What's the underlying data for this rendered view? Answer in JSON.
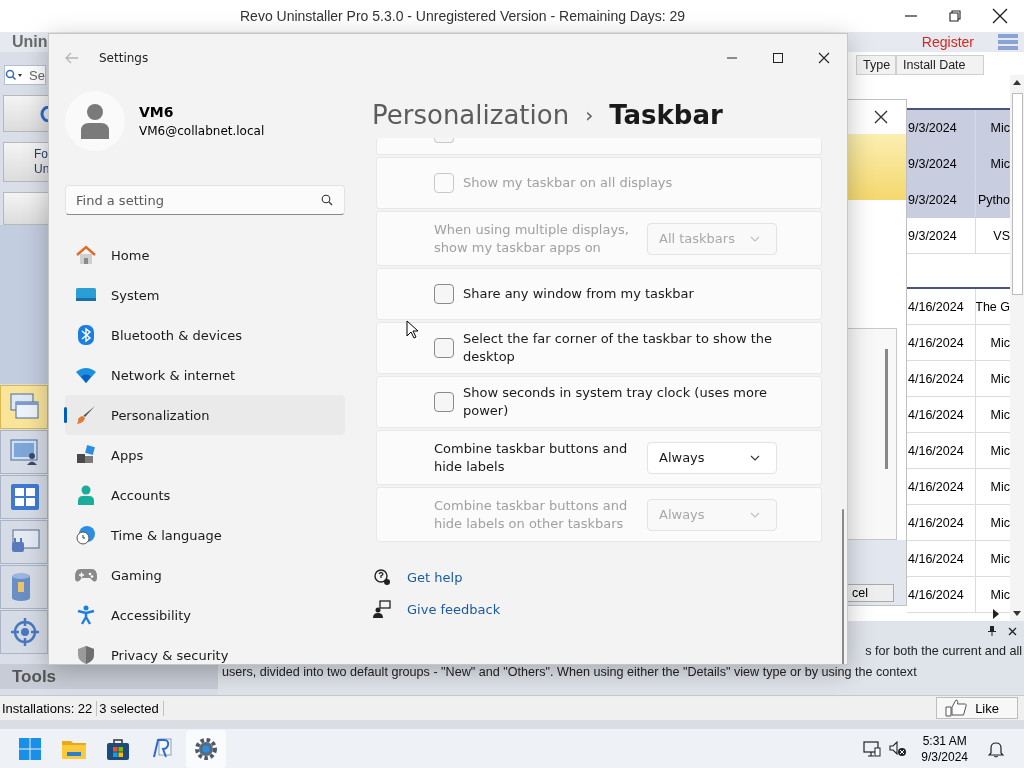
{
  "background_app": {
    "title": "Revo Uninstaller Pro 5.3.0 - Unregistered Version - Remaining Days: 29",
    "ribbon_tab": "Unin",
    "register": "Register",
    "sidebar": {
      "search_placeholder": "Se",
      "button_lines": [
        "Fo",
        "Un"
      ],
      "tools_label": "Tools",
      "tiles": [
        {
          "selected": true
        },
        {
          "selected": false
        },
        {
          "selected": false
        },
        {
          "selected": false
        },
        {
          "selected": false
        },
        {
          "selected": false
        }
      ]
    },
    "table": {
      "columns": [
        "Type",
        "Install Date"
      ],
      "groups": [
        {
          "rows": [
            {
              "install_date": "9/3/2024",
              "column_3": "Mic",
              "selected": true
            },
            {
              "install_date": "9/3/2024",
              "column_3": "Mic",
              "selected": true
            },
            {
              "install_date": "9/3/2024",
              "column_3": "Pytho",
              "selected": true
            },
            {
              "install_date": "9/3/2024",
              "column_3": "VS",
              "selected": false
            }
          ]
        },
        {
          "rows": [
            {
              "install_date": "4/16/2024",
              "column_3": "The G",
              "selected": false
            },
            {
              "install_date": "4/16/2024",
              "column_3": "Mic",
              "selected": false
            },
            {
              "install_date": "4/16/2024",
              "column_3": "Mic",
              "selected": false
            },
            {
              "install_date": "4/16/2024",
              "column_3": "Mic",
              "selected": false
            },
            {
              "install_date": "4/16/2024",
              "column_3": "Mic",
              "selected": false
            },
            {
              "install_date": "4/16/2024",
              "column_3": "Mic",
              "selected": false
            },
            {
              "install_date": "4/16/2024",
              "column_3": "Mic",
              "selected": false
            },
            {
              "install_date": "4/16/2024",
              "column_3": "Mic",
              "selected": false
            },
            {
              "install_date": "4/16/2024",
              "column_3": "Mic",
              "selected": false
            }
          ]
        }
      ]
    },
    "dialog": {
      "button": "cel"
    },
    "description": [
      "s for both the current and all",
      "users, divided into two default groups - \"New\" and \"Others\". When using either the \"Details\" view type or by using the context"
    ],
    "status_bar": {
      "installations": "Installations: 22",
      "selected": "3 selected",
      "like": "Like"
    }
  },
  "settings_window": {
    "title": "Settings",
    "user": {
      "name": "VM6",
      "email": "VM6@collabnet.local"
    },
    "search": {
      "placeholder": "Find a setting"
    },
    "nav": [
      {
        "label": "Home",
        "selected": false
      },
      {
        "label": "System",
        "selected": false
      },
      {
        "label": "Bluetooth & devices",
        "selected": false
      },
      {
        "label": "Network & internet",
        "selected": false
      },
      {
        "label": "Personalization",
        "selected": true
      },
      {
        "label": "Apps",
        "selected": false
      },
      {
        "label": "Accounts",
        "selected": false
      },
      {
        "label": "Time & language",
        "selected": false
      },
      {
        "label": "Gaming",
        "selected": false
      },
      {
        "label": "Accessibility",
        "selected": false
      },
      {
        "label": "Privacy & security",
        "selected": false
      }
    ],
    "breadcrumb": {
      "parent": "Personalization",
      "separator": "›",
      "current": "Taskbar"
    },
    "settings": [
      {
        "kind": "clipped",
        "checked": false,
        "disabled": true
      },
      {
        "kind": "checkbox",
        "label": "Show my taskbar on all displays",
        "checked": false,
        "disabled": true
      },
      {
        "kind": "dropdown",
        "label": "When using multiple displays, show my taskbar apps on",
        "value": "All taskbars",
        "disabled": true
      },
      {
        "kind": "checkbox",
        "label": "Share any window from my taskbar",
        "checked": false,
        "disabled": false
      },
      {
        "kind": "checkbox",
        "label": "Select the far corner of the taskbar to show the desktop",
        "checked": false,
        "disabled": false
      },
      {
        "kind": "checkbox",
        "label": "Show seconds in system tray clock (uses more power)",
        "checked": false,
        "disabled": false
      },
      {
        "kind": "dropdown",
        "label": "Combine taskbar buttons and hide labels",
        "value": "Always",
        "disabled": false
      },
      {
        "kind": "dropdown",
        "label": "Combine taskbar buttons and hide labels on other taskbars",
        "value": "Always",
        "disabled": true
      }
    ],
    "links": [
      "Get help",
      "Give feedback"
    ]
  },
  "taskbar": {
    "apps": [
      {
        "active": false
      },
      {
        "active": false
      },
      {
        "active": false
      },
      {
        "active": false
      },
      {
        "active": true
      }
    ],
    "time": "5:31 AM",
    "date": "9/3/2024"
  }
}
